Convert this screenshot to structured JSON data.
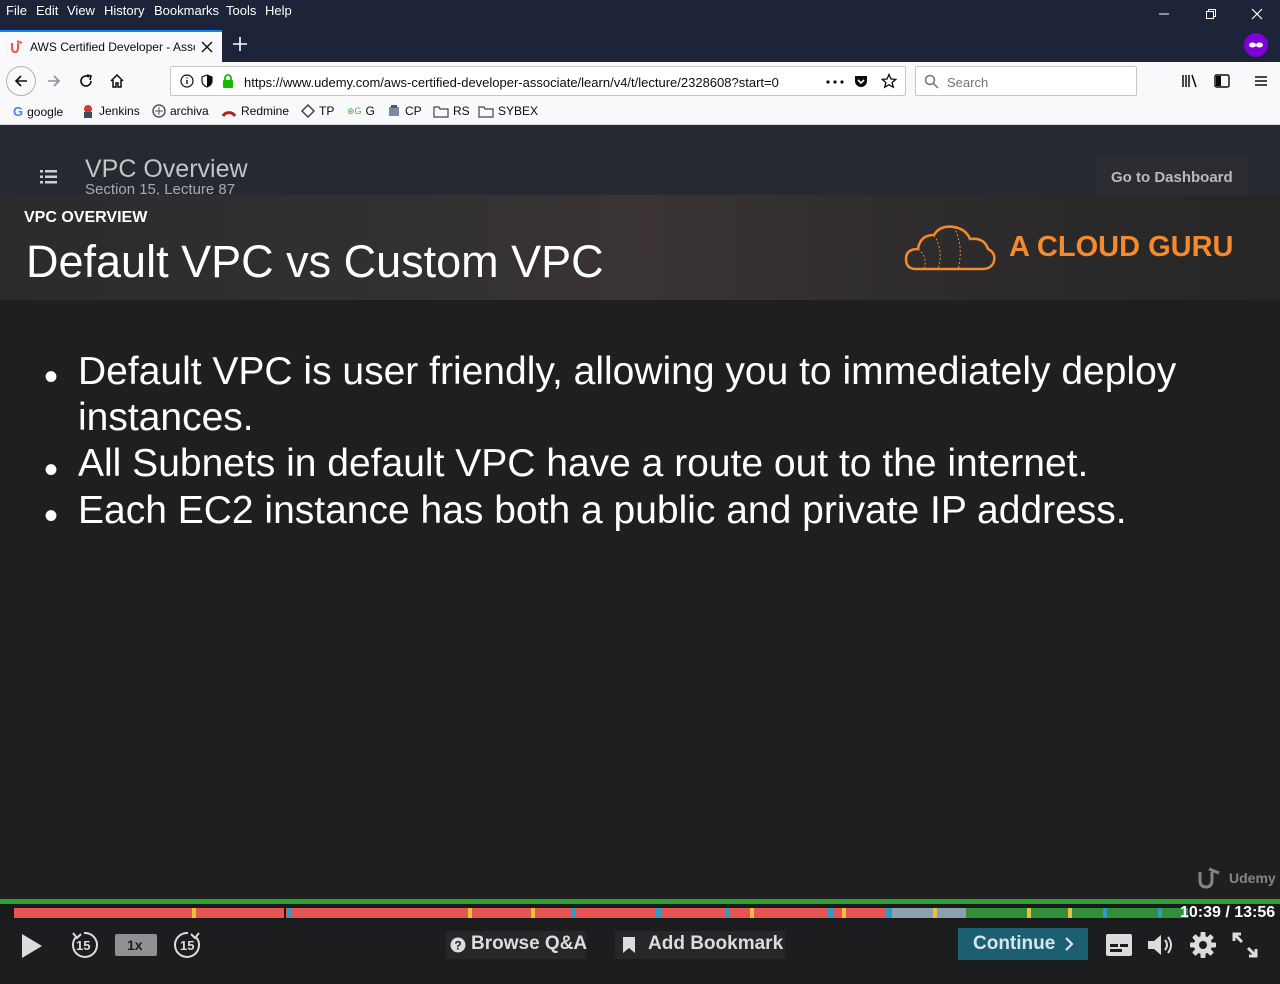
{
  "menubar": {
    "items": [
      "File",
      "Edit",
      "View",
      "History",
      "Bookmarks",
      "Tools",
      "Help"
    ]
  },
  "tab": {
    "title": "AWS Certified Developer - Associate"
  },
  "navbar": {
    "url": "https://www.udemy.com/aws-certified-developer-associate/learn/v4/t/lecture/2328608?start=0",
    "search_placeholder": "Search"
  },
  "bookmarks": [
    "google",
    "Jenkins",
    "archiva",
    "Redmine",
    "TP",
    "G",
    "CP",
    "RS",
    "SYBEX"
  ],
  "player_header": {
    "title": "VPC Overview",
    "subtitle": "Section 15, Lecture 87",
    "dashboard": "Go to Dashboard"
  },
  "slide": {
    "section": "VPC OVERVIEW",
    "title": "Default VPC vs Custom VPC",
    "logo_text": "A CLOUD GURU",
    "bullets": [
      "Default VPC is user friendly, allowing you to immediately deploy instances.",
      "All Subnets in default VPC have a route out to the internet.",
      "Each EC2 instance has both a public and private IP address."
    ],
    "watermark": "Udemy"
  },
  "controls": {
    "rewind": "15",
    "speed": "1x",
    "forward": "15",
    "qa": "Browse Q&A",
    "bookmark": "Add Bookmark",
    "continue": "Continue",
    "time": "10:39 / 13:56"
  },
  "colors": {
    "accent": "#0a84ff",
    "progress": "#2aa132",
    "logo": "#f5892d",
    "continue_bg": "#1c5f72"
  }
}
